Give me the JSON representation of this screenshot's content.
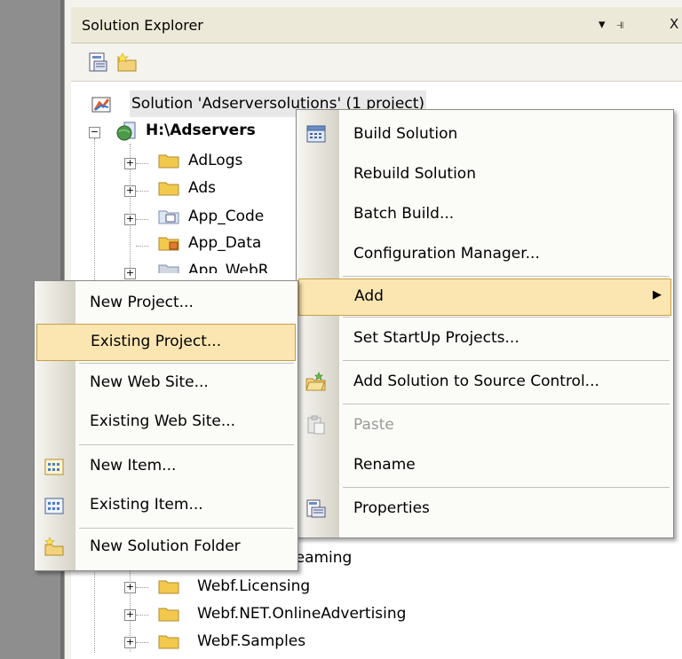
{
  "panel": {
    "title": "Solution Explorer",
    "controls": [
      "▾",
      "⫣",
      "X"
    ]
  },
  "tree": {
    "solution_label": "Solution 'Adserversolutions' (1 project)",
    "project_label": "H:\\Adservers",
    "items": [
      {
        "label": "AdLogs",
        "icon": "folder-icon"
      },
      {
        "label": "Ads",
        "icon": "folder-icon"
      },
      {
        "label": "App_Code",
        "icon": "app-code-folder-icon"
      },
      {
        "label": "App_Data",
        "icon": "app-data-folder-icon"
      },
      {
        "label": "App_WebR",
        "icon": "app-webref-folder-icon"
      }
    ],
    "bottom_items": [
      {
        "label": "reaming",
        "icon": "folder-icon"
      },
      {
        "label": "Webf.Licensing",
        "icon": "folder-icon"
      },
      {
        "label": "Webf.NET.OnlineAdvertising",
        "icon": "folder-icon"
      },
      {
        "label": "WebF.Samples",
        "icon": "folder-icon"
      }
    ]
  },
  "context_menu": {
    "items": [
      {
        "label": "Build Solution",
        "icon": "build-icon"
      },
      {
        "label": "Rebuild Solution"
      },
      {
        "label": "Batch Build..."
      },
      {
        "label": "Configuration Manager..."
      },
      {
        "label": "Add",
        "submenu_arrow": "▶"
      },
      {
        "label": "Set StartUp Projects..."
      },
      {
        "label": "Add Solution to Source Control...",
        "icon": "source-control-icon"
      },
      {
        "label": "Paste",
        "icon": "paste-icon",
        "disabled": true
      },
      {
        "label": "Rename"
      },
      {
        "label": "Properties",
        "icon": "properties-icon"
      }
    ]
  },
  "submenu": {
    "items": [
      {
        "label": "New Project..."
      },
      {
        "label": "Existing Project..."
      },
      {
        "label": "New Web Site..."
      },
      {
        "label": "Existing Web Site..."
      },
      {
        "label": "New Item...",
        "icon": "new-item-icon"
      },
      {
        "label": "Existing Item...",
        "icon": "existing-item-icon"
      },
      {
        "label": "New Solution Folder",
        "icon": "new-folder-icon"
      }
    ]
  },
  "colors": {
    "highlight": "#fbe6b2",
    "highlight_border": "#c79e4c",
    "folder": "#f2c94c"
  }
}
